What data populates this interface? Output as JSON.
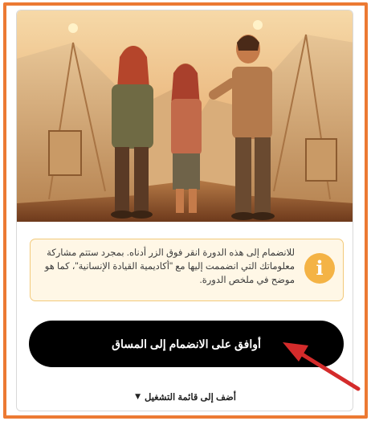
{
  "info": {
    "text": "للانضمام إلى هذه الدورة انقر فوق الزر أدناه. بمجرد ستتم مشاركة معلوماتك التي انضممت إليها مع \"أكاديمية القيادة الإنسانية\"، كما هو موضح في ملخص الدورة.",
    "icon": "info-icon"
  },
  "actions": {
    "join_label": "أوافق على الانضمام إلى المساق",
    "playlist_label": "أضف إلى قائمة التشغيل",
    "playlist_icon": "chevron-down-icon"
  },
  "colors": {
    "frame": "#ec7a33",
    "info_bg": "#fff7e6",
    "info_icon": "#f4b345",
    "button": "#000000",
    "arrow": "#d42b2b"
  }
}
